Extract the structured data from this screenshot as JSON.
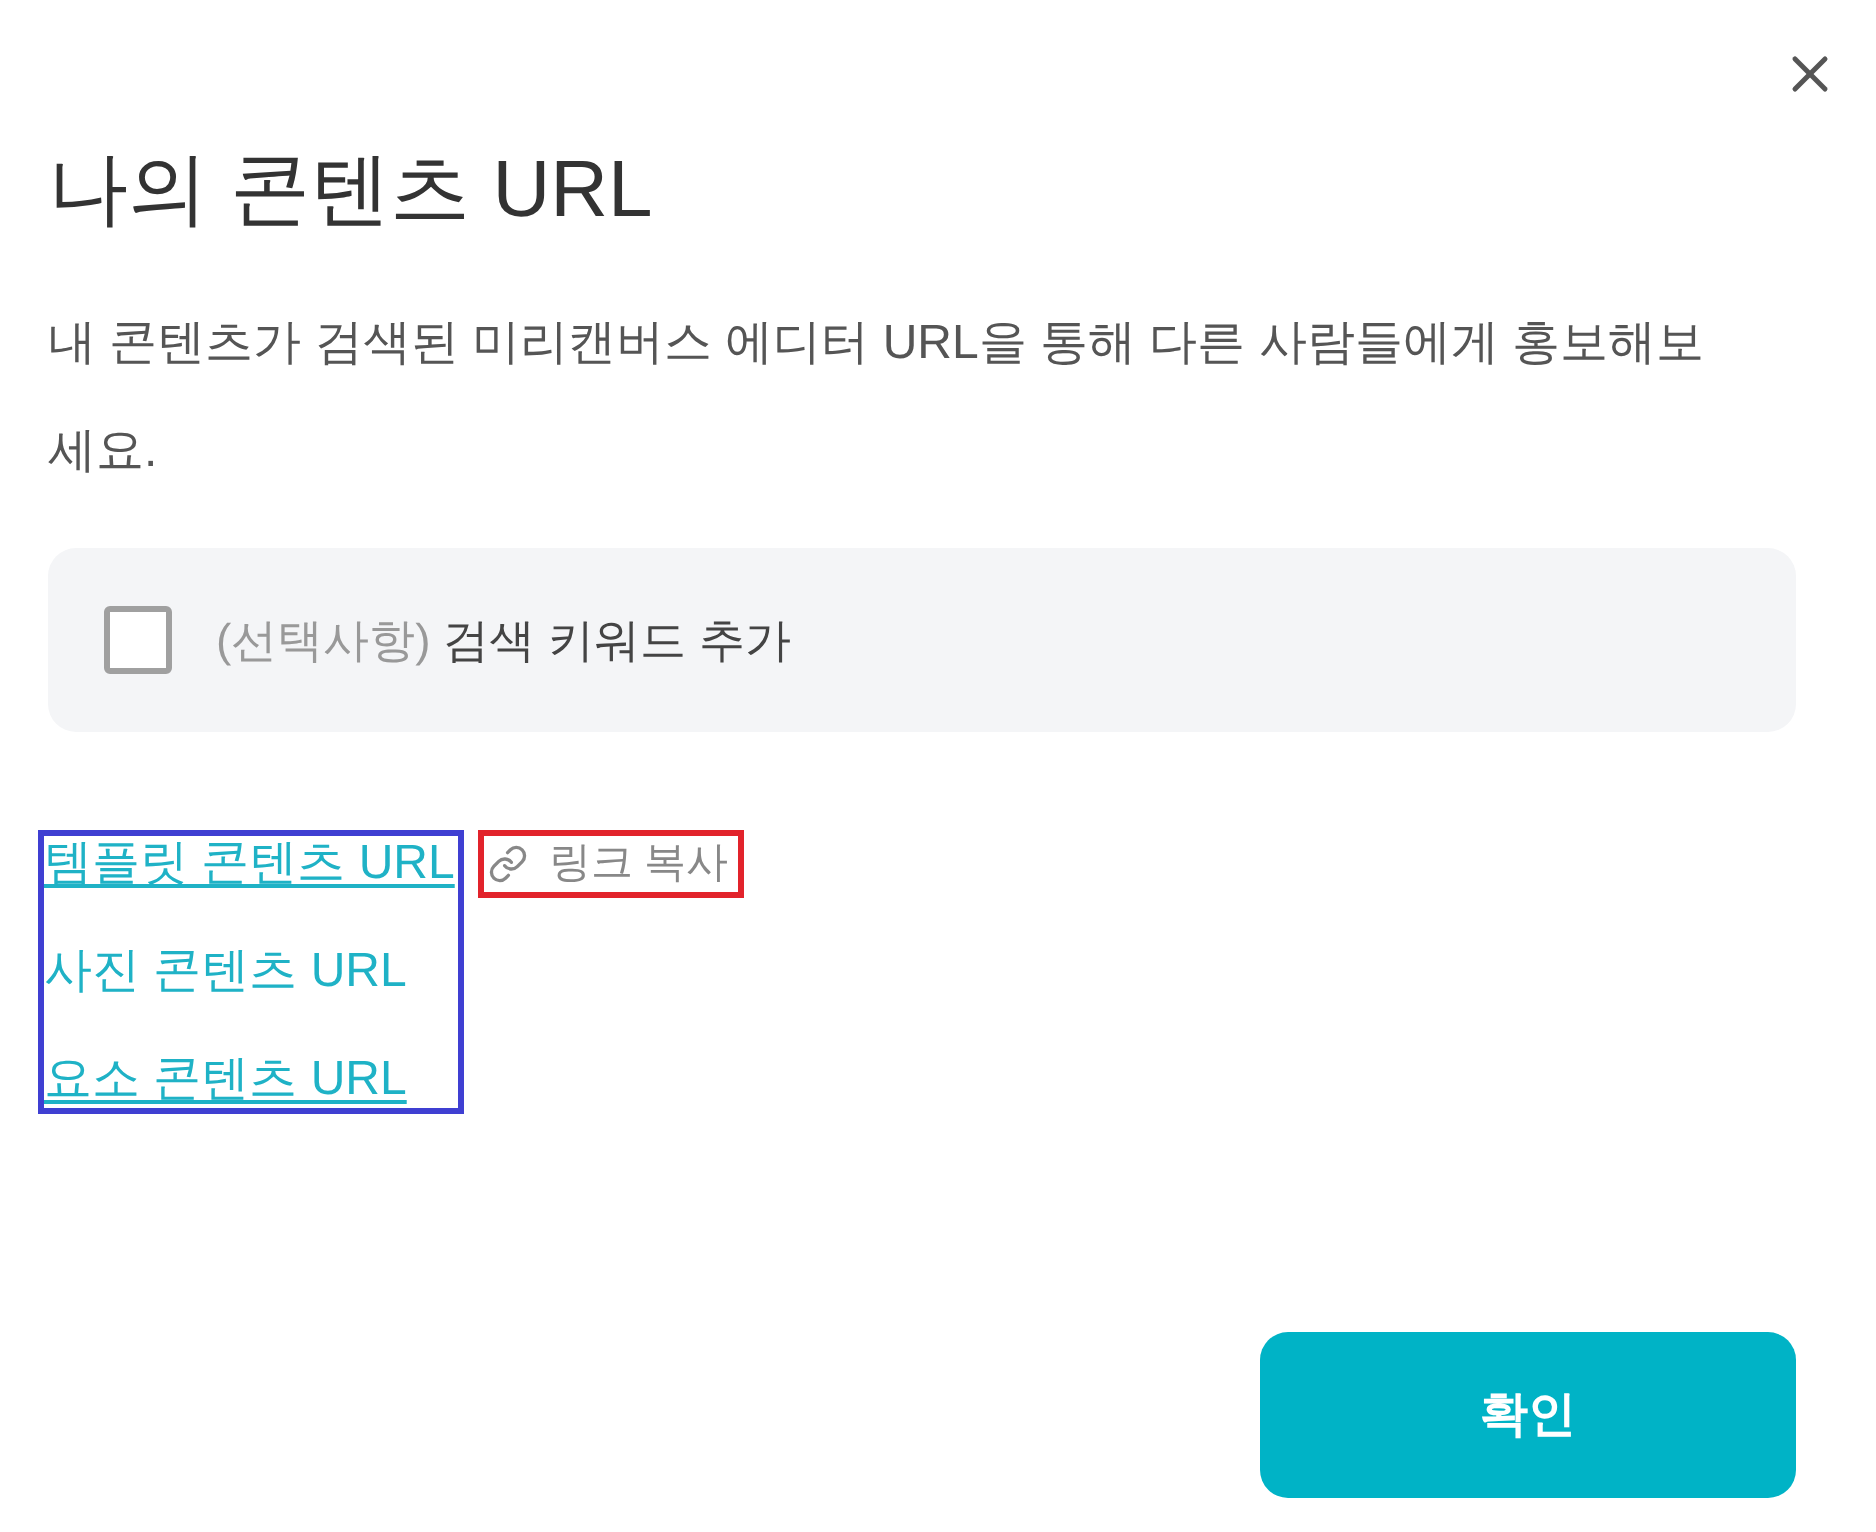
{
  "title": "나의 콘텐츠 URL",
  "description": "내 콘텐츠가 검색된 미리캔버스 에디터 URL을 통해 다른 사람들에게 홍보해보세요.",
  "keyword_option": {
    "optional_tag": "(선택사항)",
    "label": "검색 키워드 추가",
    "checked": false
  },
  "links": [
    {
      "label": "템플릿 콘텐츠 URL",
      "underlined": true
    },
    {
      "label": "사진 콘텐츠 URL",
      "underlined": false
    },
    {
      "label": "요소 콘텐츠 URL",
      "underlined": true
    }
  ],
  "copy_link": {
    "label": "링크 복사"
  },
  "confirm_button": {
    "label": "확인"
  }
}
